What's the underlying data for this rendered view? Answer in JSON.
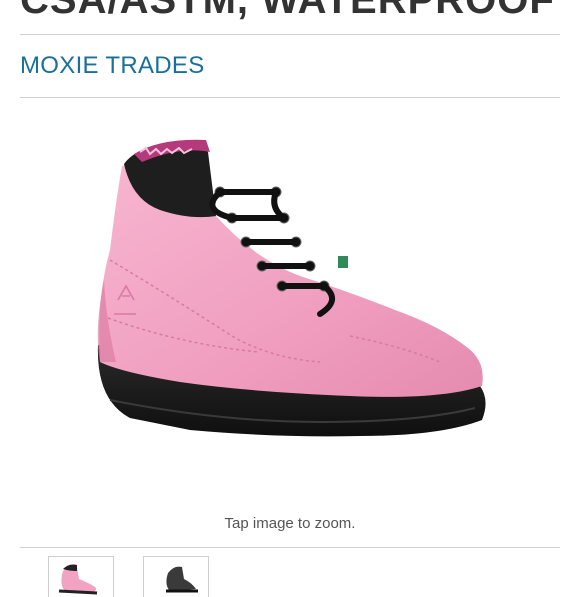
{
  "product": {
    "title": "CSA/ASTM, WATERPROOF",
    "brand": "MOXIE TRADES"
  },
  "image_viewer": {
    "zoom_hint": "Tap image to zoom.",
    "thumbnails": [
      {
        "icon": "pink-boot-thumbnail"
      },
      {
        "icon": "black-boot-thumbnail"
      }
    ]
  },
  "colors": {
    "brand_link": "#1a6f9b",
    "title_text": "#333333",
    "boot_pink": "#f2a3c4",
    "sole": "#1c1c1c"
  }
}
